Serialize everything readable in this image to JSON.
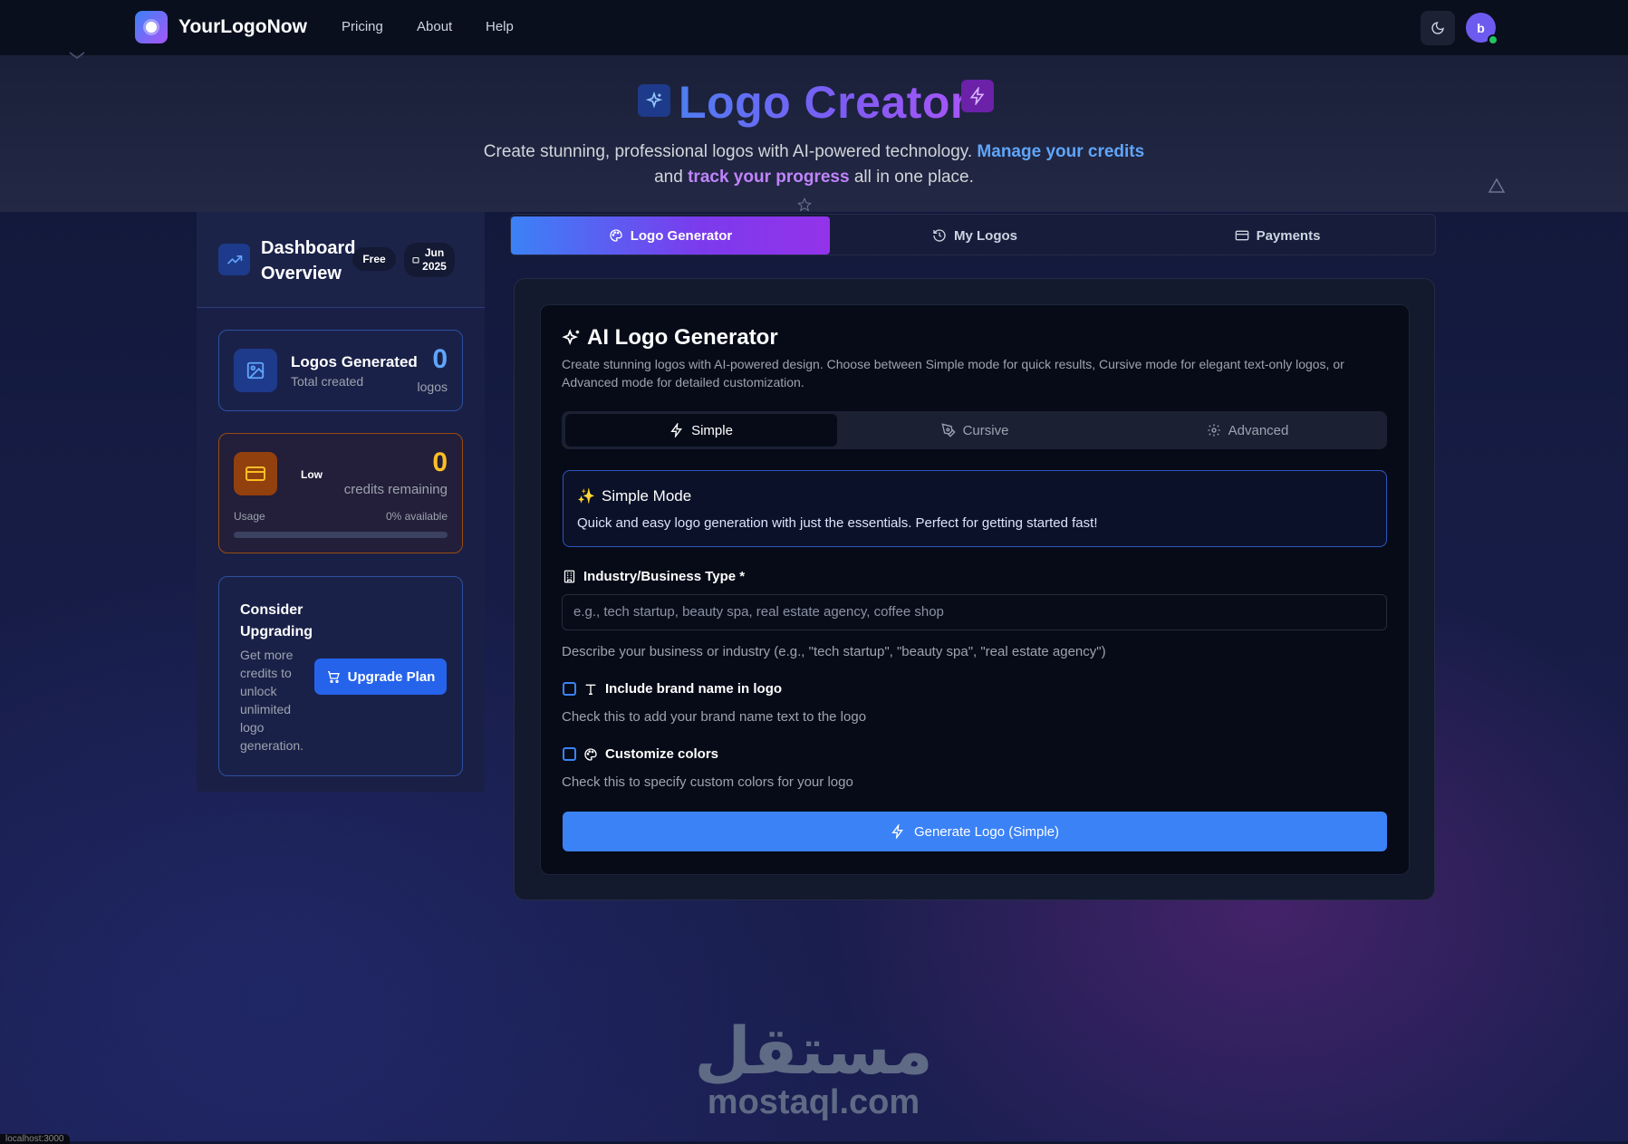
{
  "nav": {
    "brand": "YourLogoNow",
    "links": [
      "Pricing",
      "About",
      "Help"
    ],
    "avatar_initial": "b"
  },
  "hero": {
    "title": "Logo Creator",
    "subtitle_part1": "Create stunning, professional logos with AI-powered technology.",
    "subtitle_link1": "Manage your credits",
    "subtitle_part2": "and",
    "subtitle_link2": "track your progress",
    "subtitle_part3": "all in one place."
  },
  "sidebar": {
    "title": "Dashboard Overview",
    "plan_badge": "Free",
    "date_month": "Jun",
    "date_year": "2025",
    "logos_card": {
      "title": "Logos Generated",
      "subtitle": "Total created",
      "value": "0",
      "unit": "logos"
    },
    "credits_card": {
      "badge": "Low",
      "value": "0",
      "unit": "credits remaining",
      "usage_label": "Usage",
      "available": "0% available",
      "usage_fraction": 0
    },
    "upgrade_card": {
      "title": "Consider Upgrading",
      "text": "Get more credits to unlock unlimited logo generation.",
      "button": "Upgrade Plan"
    }
  },
  "tabs": [
    {
      "label": "Logo Generator",
      "icon": "palette-icon",
      "active": true
    },
    {
      "label": "My Logos",
      "icon": "history-icon",
      "active": false
    },
    {
      "label": "Payments",
      "icon": "credit-card-icon",
      "active": false
    }
  ],
  "generator": {
    "title": "AI Logo Generator",
    "description": "Create stunning logos with AI-powered design. Choose between Simple mode for quick results, Cursive mode for elegant text-only logos, or Advanced mode for detailed customization.",
    "modes": [
      {
        "label": "Simple",
        "icon": "bolt-icon",
        "active": true
      },
      {
        "label": "Cursive",
        "icon": "pen-tool-icon",
        "active": false
      },
      {
        "label": "Advanced",
        "icon": "gear-icon",
        "active": false
      }
    ],
    "info": {
      "title": "Simple Mode",
      "text": "Quick and easy logo generation with just the essentials. Perfect for getting started fast!"
    },
    "industry": {
      "label": "Industry/Business Type *",
      "placeholder": "e.g., tech startup, beauty spa, real estate agency, coffee shop",
      "hint": "Describe your business or industry (e.g., \"tech startup\", \"beauty spa\", \"real estate agency\")"
    },
    "brand_name": {
      "label": "Include brand name in logo",
      "hint": "Check this to add your brand name text to the logo",
      "checked": false
    },
    "colors": {
      "label": "Customize colors",
      "hint": "Check this to specify custom colors for your logo",
      "checked": false
    },
    "button": "Generate Logo (Simple)"
  },
  "watermark": {
    "arabic": "مستقل",
    "latin": "mostaql.com"
  },
  "footer_tiny": "localhost:3000",
  "colors": {
    "accent_blue": "#3b82f6",
    "accent_purple": "#9333ea",
    "warning": "#f59e0b",
    "success": "#22c55e"
  }
}
